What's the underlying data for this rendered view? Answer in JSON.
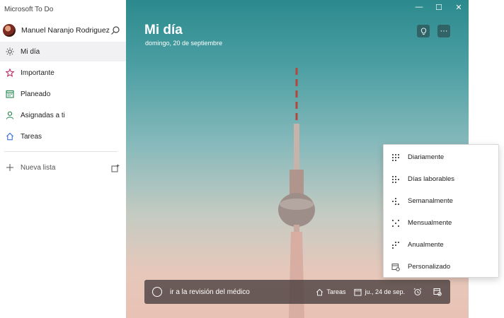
{
  "app": {
    "title": "Microsoft To Do"
  },
  "user": {
    "name": "Manuel Naranjo Rodriguez"
  },
  "sidebar": {
    "items": [
      {
        "label": "Mi día",
        "icon": "sun-icon",
        "active": true
      },
      {
        "label": "Importante",
        "icon": "star-icon"
      },
      {
        "label": "Planeado",
        "icon": "calendar-icon"
      },
      {
        "label": "Asignadas a ti",
        "icon": "person-icon"
      },
      {
        "label": "Tareas",
        "icon": "home-icon"
      }
    ],
    "new_list_label": "Nueva lista"
  },
  "main": {
    "title": "Mi día",
    "date": "domingo, 20 de septiembre",
    "window_controls": {
      "minimize": "—",
      "maximize": "☐",
      "close": "✕"
    },
    "header_buttons": {
      "suggestions": "lightbulb-icon",
      "more": "···"
    }
  },
  "task_input": {
    "value": "ir a la revisión del médico",
    "list_label": "Tareas",
    "due_label": "ju., 24 de sep."
  },
  "repeat_menu": {
    "items": [
      {
        "label": "Diariamente",
        "icon": "repeat-daily-icon"
      },
      {
        "label": "Días laborables",
        "icon": "repeat-weekdays-icon"
      },
      {
        "label": "Semanalmente",
        "icon": "repeat-weekly-icon"
      },
      {
        "label": "Mensualmente",
        "icon": "repeat-monthly-icon"
      },
      {
        "label": "Anualmente",
        "icon": "repeat-yearly-icon"
      },
      {
        "label": "Personalizado",
        "icon": "calendar-custom-icon"
      }
    ]
  },
  "colors": {
    "accent": "#2564cf",
    "important_star": "#c2185b",
    "planned": "#107c41",
    "assigned": "#107c41",
    "tasks": "#2564cf"
  }
}
